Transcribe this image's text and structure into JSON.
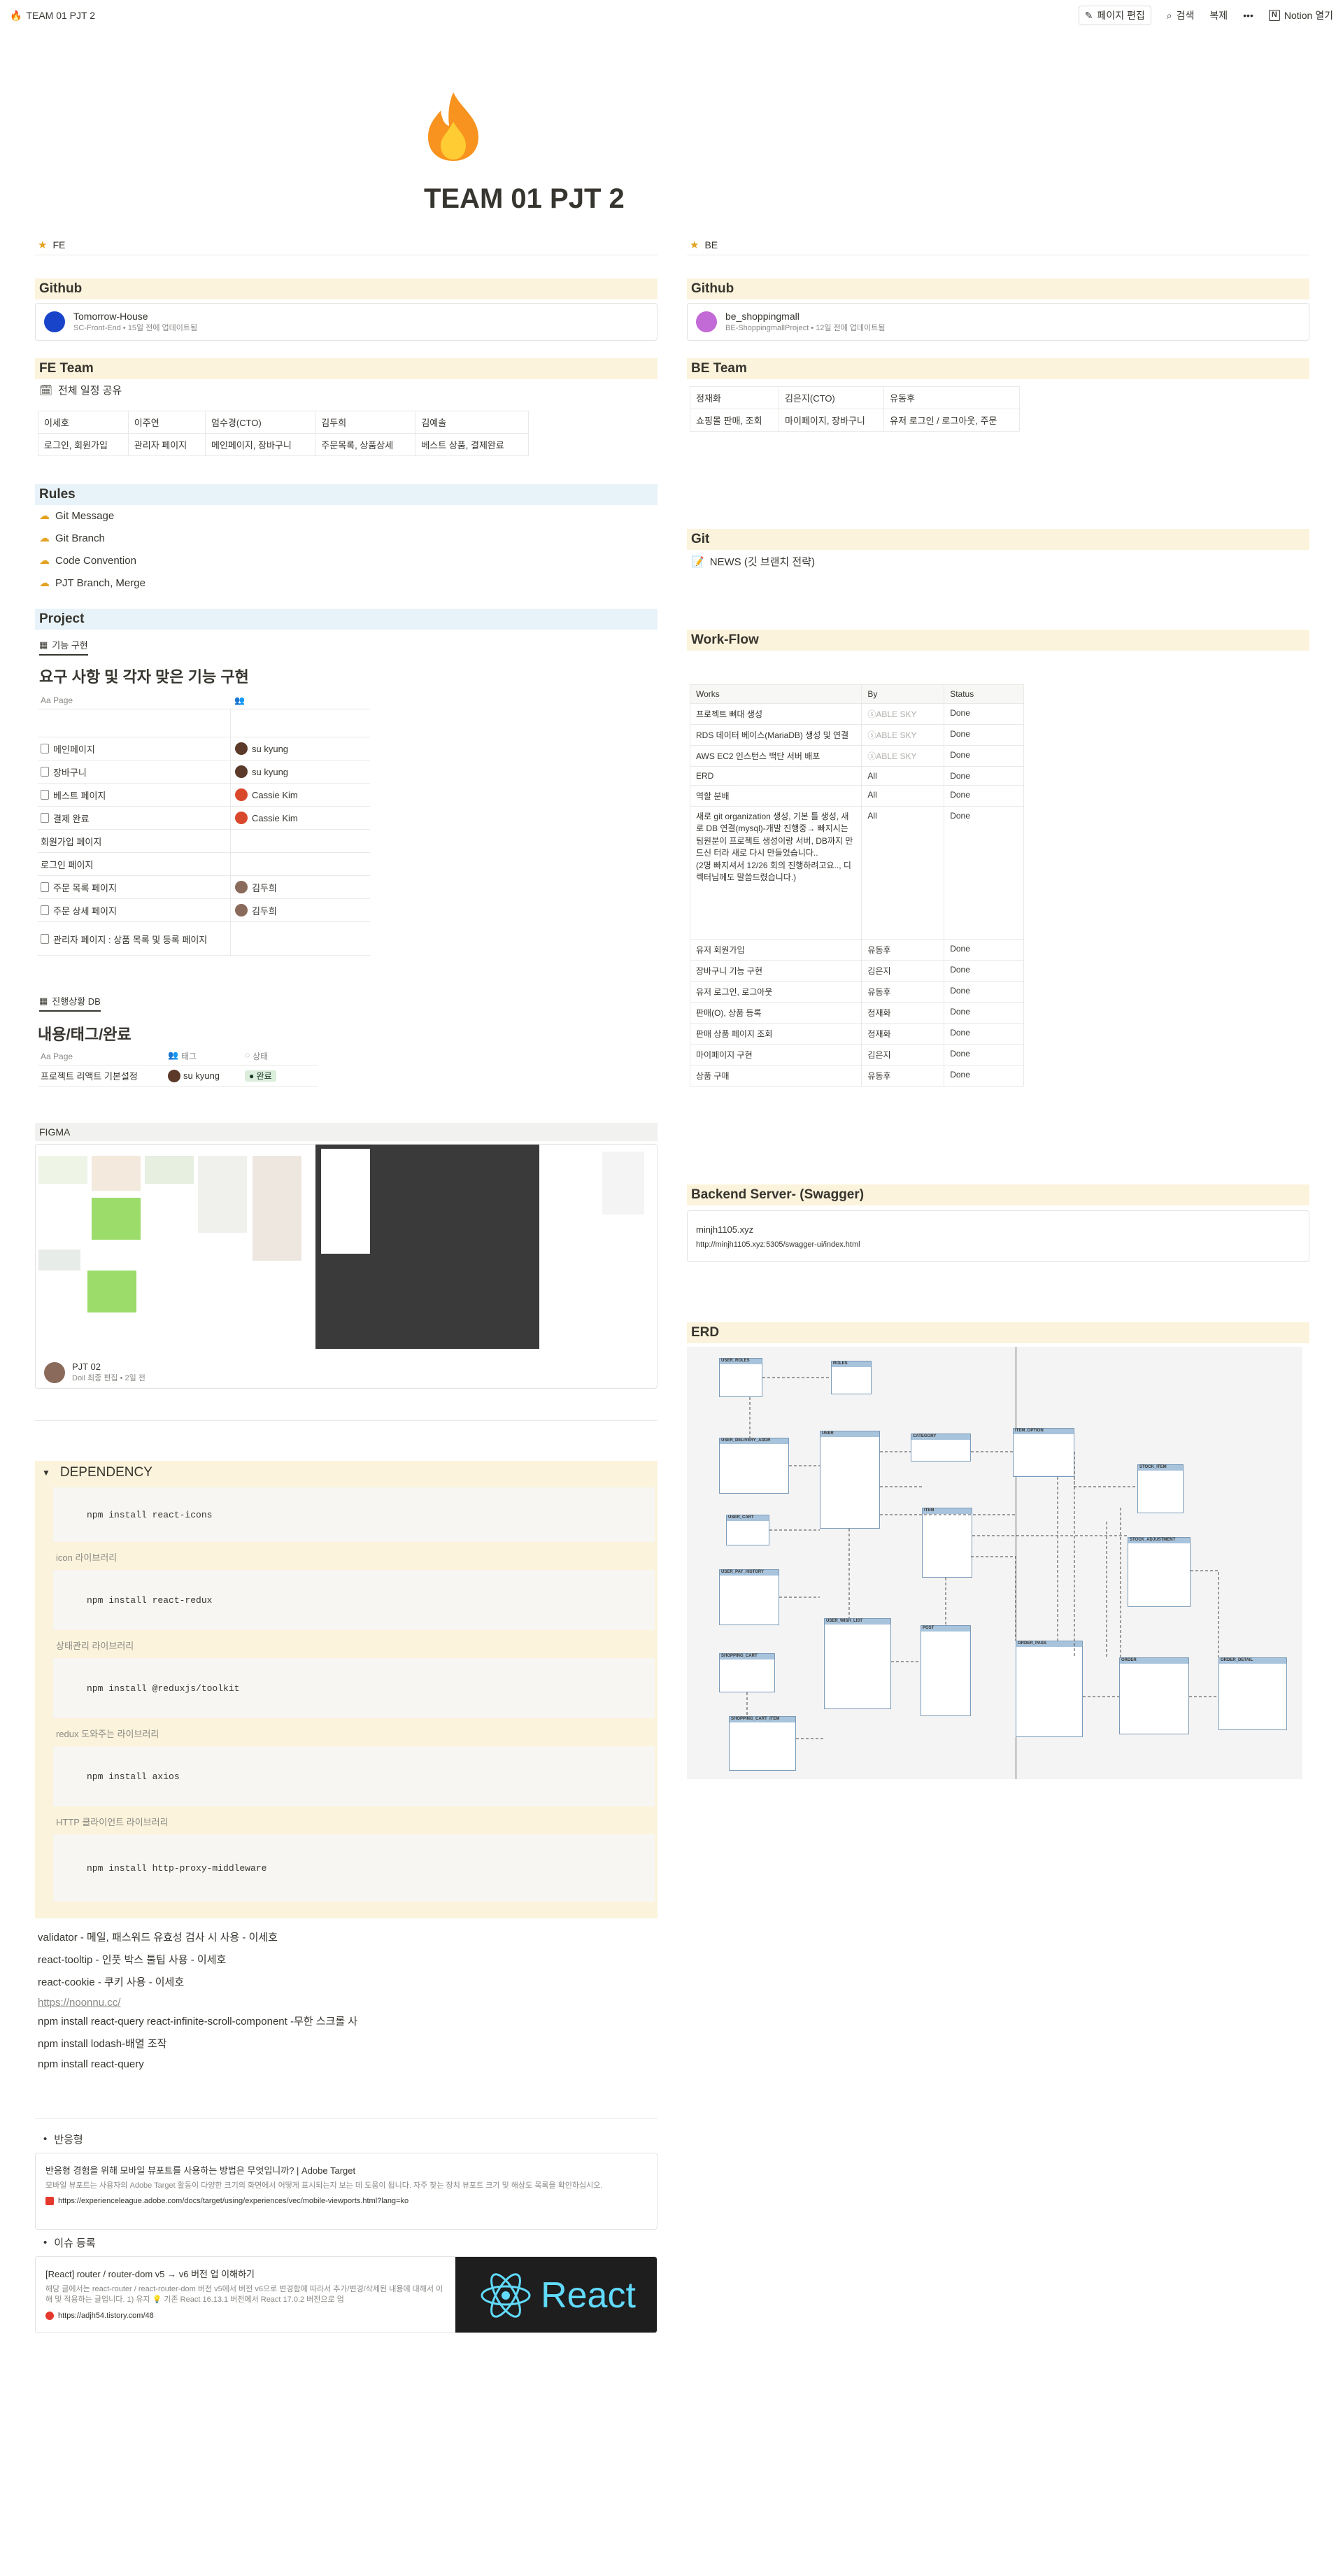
{
  "topbar": {
    "title": "TEAM 01 PJT 2",
    "edit": "페이지 편집",
    "search": "검색",
    "copy": "복제",
    "more": "•••",
    "open": "Notion 열기"
  },
  "page": {
    "title": "TEAM 01 PJT 2"
  },
  "fe": {
    "colhead": "FE",
    "github_heading": "Github",
    "github": {
      "title": "Tomorrow-House",
      "sub": "SC-Front-End • 15일 전에 업데이트됨"
    },
    "team_heading": "FE Team",
    "schedule": "전체 일정 공유",
    "team_table": {
      "headers": [
        "이세호",
        "이주연",
        "엄수경(CTO)",
        "김두희",
        "김예솔"
      ],
      "row": [
        "로그인, 회원가입",
        "관리자 페이지",
        "메인페이지, 장바구니",
        "주문목록, 상품상세",
        "베스트 상품, 결제완료"
      ]
    },
    "rules_heading": "Rules",
    "rules": [
      "Git Message",
      "Git Branch",
      "Code Convention",
      "PJT Branch, Merge"
    ],
    "project_heading": "Project",
    "db1": {
      "tab": "기능 구현",
      "title": "요구 사항 및 각자 맞은 기능 구현",
      "col_page": "Aa Page",
      "col_people": "👥",
      "rows": [
        {
          "name": "메인페이지",
          "person": "su kyung"
        },
        {
          "name": "장바구니",
          "person": "su kyung"
        },
        {
          "name": "베스트 페이지",
          "person": "Cassie Kim"
        },
        {
          "name": "결제 완료",
          "person": "Cassie Kim"
        },
        {
          "name": "회원가입 페이지",
          "person": ""
        },
        {
          "name": "로그인 페이지",
          "person": ""
        },
        {
          "name": "주문 목록 페이지",
          "person": "김두희"
        },
        {
          "name": "주문 상세 페이지",
          "person": "김두희"
        },
        {
          "name": "관리자 페이지 : 상품 목록 및 등록 페이지",
          "person": ""
        }
      ]
    },
    "db2": {
      "tab": "진행상황 DB",
      "title": "내용/태그/완료",
      "col_page": "Aa Page",
      "col_tag": "태그",
      "col_status": "상태",
      "row": {
        "name": "프로젝트 리액트 기본설정",
        "person": "su kyung",
        "status": "완료"
      }
    },
    "figma": {
      "heading": "FIGMA",
      "title": "PJT 02",
      "sub": "Doil 최종 편집 • 2일 전"
    },
    "dependency": {
      "heading": "DEPENDENCY",
      "items": [
        {
          "cmd": "npm install react-icons",
          "cap": "icon 라이브러리"
        },
        {
          "cmd": "npm install react-redux",
          "cap": "상태관리 라이브러리"
        },
        {
          "cmd": "npm install @reduxjs/toolkit",
          "cap": "redux 도와주는 라이브러리"
        },
        {
          "cmd": "npm install axios",
          "cap": "HTTP 클라이언트 라이브러리"
        },
        {
          "cmd": "npm install http-proxy-middleware",
          "cap": ""
        }
      ]
    },
    "notes": [
      "validator - 메일, 패스워드 유효성 검사 시 사용 - 이세호",
      "react-tooltip - 인풋 박스 툴팁 사용 - 이세호",
      "react-cookie - 쿠키 사용 - 이세호",
      "https://noonnu.cc/",
      "npm install react-query react-infinite-scroll-component -무한 스크롤 사",
      "npm install lodash-배열 조작",
      "npm install react-query"
    ],
    "responsive": {
      "label": "반응형",
      "title": "반응형 경험을 위해 모바일 뷰포트를 사용하는 방법은 무엇입니까? | Adobe Target",
      "desc": "모바일 뷰포트는 사용자의 Adobe Target 활동이 다양한 크기의 화면에서 어떻게 표시되는지 보는 데 도움이 됩니다. 자주 찾는 장치 뷰포트 크기 및 해상도 목록을 확인하십시오.",
      "url": "https://experienceleague.adobe.com/docs/target/using/experiences/vec/mobile-viewports.html?lang=ko"
    },
    "issue": {
      "label": "이슈 등록",
      "title": "[React] router / router-dom v5 → v6 버전 업 이해하기",
      "desc": "해당 글에서는 react-router / react-router-dom 버전 v5에서 버전 v6으로 변경함에 따라서 추가/변경/삭제된 내용에 대해서 이해 및 적용하는 글입니다. 1) 유지 💡 기존 React 16.13.1 버전에서 React 17.0.2 버전으로 업",
      "url": "https://adjh54.tistory.com/48",
      "image_text": "React"
    }
  },
  "be": {
    "colhead": "BE",
    "github_heading": "Github",
    "github": {
      "title": "be_shoppingmall",
      "sub": "BE-ShoppingmallProject • 12일 전에 업데이트됨"
    },
    "team_heading": "BE Team",
    "team_table": {
      "headers": [
        "정재화",
        "김은지(CTO)",
        "유동후"
      ],
      "row": [
        "쇼핑몰 판매, 조회",
        "마이페이지, 장바구니",
        "유저 로그인 / 로그아웃, 주문"
      ]
    },
    "git_heading": "Git",
    "git_link": "NEWS (깃 브랜치 전략)",
    "workflow_heading": "Work-Flow",
    "workflow": {
      "headers": [
        "Works",
        "By",
        "Status"
      ],
      "rows": [
        [
          "프로젝트 뼈대 생성",
          "ⓢABLE SKY",
          "Done"
        ],
        [
          "RDS 데이터 베이스(MariaDB) 생성 및 연결",
          "ⓢABLE SKY",
          "Done"
        ],
        [
          "AWS EC2 인스턴스 백단 서버 배포",
          "ⓢABLE SKY",
          "Done"
        ],
        [
          "ERD",
          "All",
          "Done"
        ],
        [
          "역할 분배",
          "All",
          "Done"
        ],
        [
          "새로 git organization 생성, 기본 틀 생성, 새로 DB 연결(mysql)-개발 진행중→ 빠지시는 팀원분이 프로젝트 생성이랑 서버, DB까지 만드신 터라 새로 다시 만들었습니다..\n(2명 빠지셔서 12/26 회의 진행하려고요.., 디렉터님께도 말씀드렸습니다.)",
          "All",
          "Done"
        ],
        [
          "유저 회원가입",
          "유동후",
          "Done"
        ],
        [
          "장바구니 기능 구현",
          "김은지",
          "Done"
        ],
        [
          "유저 로그인, 로그아웃",
          "유동후",
          "Done"
        ],
        [
          "판매(O), 상품 등록",
          "정재화",
          "Done"
        ],
        [
          "판매 상품 페이지 조회",
          "정재화",
          "Done"
        ],
        [
          "마이페이지 구현",
          "김은지",
          "Done"
        ],
        [
          "상품 구매",
          "유동후",
          "Done"
        ]
      ]
    },
    "swagger_heading": "Backend Server- (Swagger)",
    "swagger": {
      "host": "minjh1105.xyz",
      "url": "http://minjh1105.xyz:5305/swagger-ui/index.html"
    },
    "erd_heading": "ERD",
    "erd_tables": [
      "USER_ROLES",
      "ROLES",
      "USER_DELIVERY_ADDR",
      "USER",
      "CATEGORY",
      "ITEM_OPTION",
      "STOCK_ITEM",
      "USER_CART",
      "ITEM",
      "STOCK_ADJUSTMENT",
      "USER_PAY_HISTORY",
      "USER_WISH_LIST",
      "POST",
      "ORDER_PASS",
      "ORDER",
      "ORDER_DETAIL",
      "SHOPPING_CART",
      "SHOPPING_CART_ITEM"
    ]
  }
}
